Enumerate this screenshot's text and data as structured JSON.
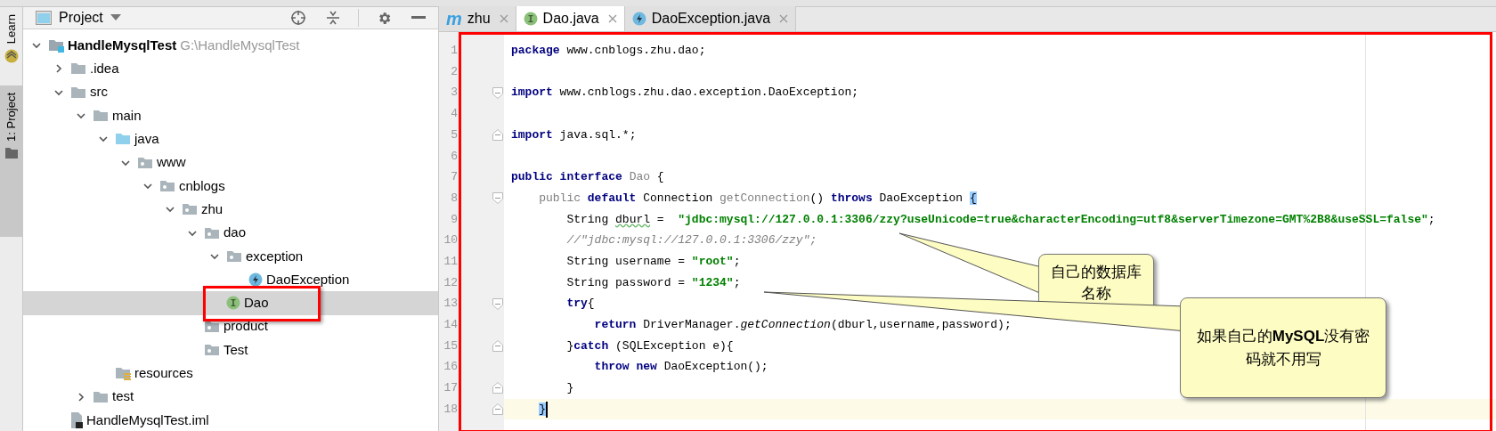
{
  "tool_strip": [
    {
      "label": "Learn",
      "kind": "learn",
      "selected": false
    },
    {
      "label": "1: Project",
      "kind": "project",
      "selected": true
    }
  ],
  "project_panel": {
    "title": "Project",
    "tree": [
      {
        "name": "HandleMysqlTest",
        "path": "G:\\HandleMysqlTest",
        "kind": "module",
        "expanded": true,
        "selected": false,
        "children": [
          {
            "name": ".idea",
            "kind": "folder",
            "expanded": false,
            "selected": false
          },
          {
            "name": "src",
            "kind": "folder",
            "expanded": true,
            "selected": false,
            "children": [
              {
                "name": "main",
                "kind": "folder",
                "expanded": true,
                "selected": false,
                "children": [
                  {
                    "name": "java",
                    "kind": "source_folder",
                    "expanded": true,
                    "selected": false,
                    "children": [
                      {
                        "name": "www",
                        "kind": "package",
                        "expanded": true,
                        "selected": false,
                        "children": [
                          {
                            "name": "cnblogs",
                            "kind": "package",
                            "expanded": true,
                            "selected": false,
                            "children": [
                              {
                                "name": "zhu",
                                "kind": "package",
                                "expanded": true,
                                "selected": false,
                                "children": [
                                  {
                                    "name": "dao",
                                    "kind": "package",
                                    "expanded": true,
                                    "selected": false,
                                    "children": [
                                      {
                                        "name": "exception",
                                        "kind": "package",
                                        "expanded": true,
                                        "selected": false,
                                        "children": [
                                          {
                                            "name": "DaoException",
                                            "kind": "exception_class",
                                            "selected": false
                                          }
                                        ]
                                      },
                                      {
                                        "name": "Dao",
                                        "kind": "interface",
                                        "selected": true
                                      }
                                    ]
                                  },
                                  {
                                    "name": "product",
                                    "kind": "package",
                                    "selected": false
                                  },
                                  {
                                    "name": "Test",
                                    "kind": "package",
                                    "selected": false
                                  }
                                ]
                              }
                            ]
                          }
                        ]
                      }
                    ]
                  },
                  {
                    "name": "resources",
                    "kind": "resources_folder",
                    "selected": false
                  }
                ]
              },
              {
                "name": "test",
                "kind": "folder",
                "expanded": false,
                "selected": false
              }
            ]
          },
          {
            "name": "HandleMysqlTest.iml",
            "kind": "iml_file",
            "selected": false
          }
        ]
      }
    ]
  },
  "editor": {
    "tabs": [
      {
        "label": "zhu",
        "kind": "module",
        "icon_text": "m",
        "selected": false
      },
      {
        "label": "Dao.java",
        "kind": "interface",
        "selected": true
      },
      {
        "label": "DaoException.java",
        "kind": "exception_class",
        "selected": false
      }
    ],
    "lines": [
      {
        "number": "1",
        "kind": "plain",
        "tokens": [
          {
            "text": "package",
            "kind": "keyword"
          },
          {
            "text": " www.cnblogs.zhu.dao;",
            "kind": "plain"
          }
        ]
      },
      {
        "number": "2",
        "kind": "plain"
      },
      {
        "number": "3",
        "kind": "fold_start",
        "tokens": [
          {
            "text": "import",
            "kind": "keyword"
          },
          {
            "text": " www.cnblogs.zhu.dao.exception.DaoException;",
            "kind": "plain"
          }
        ]
      },
      {
        "number": "4",
        "kind": "plain"
      },
      {
        "number": "5",
        "kind": "fold_end",
        "tokens": [
          {
            "text": "import",
            "kind": "keyword"
          },
          {
            "text": " java.sql.*;",
            "kind": "plain"
          }
        ]
      },
      {
        "number": "6",
        "kind": "plain"
      },
      {
        "number": "7",
        "kind": "plain",
        "tokens": [
          {
            "text": "public interface",
            "kind": "keyword"
          },
          {
            "text": " Dao",
            "kind": "unused"
          },
          {
            "text": " {",
            "kind": "plain"
          }
        ]
      },
      {
        "number": "8",
        "kind": "fold_start",
        "tokens": [
          {
            "text": "    public",
            "kind": "unused"
          },
          {
            "text": " default",
            "kind": "keyword"
          },
          {
            "text": " Connection ",
            "kind": "plain"
          },
          {
            "text": "getConnection",
            "kind": "unused"
          },
          {
            "text": "() ",
            "kind": "plain"
          },
          {
            "text": "throws",
            "kind": "keyword"
          },
          {
            "text": " DaoException ",
            "kind": "plain"
          },
          {
            "text": "{",
            "kind": "matched_brace"
          }
        ]
      },
      {
        "number": "9",
        "kind": "plain",
        "tokens": [
          {
            "text": "        String ",
            "kind": "plain"
          },
          {
            "text": "dburl",
            "kind": "typo"
          },
          {
            "text": " =  ",
            "kind": "plain"
          },
          {
            "text": "\"jdbc:mysql://127.0.0.1:3306/zzy?useUnicode=true&characterEncoding=utf8&serverTimezone=GMT%2B8&useSSL=false\"",
            "kind": "string"
          },
          {
            "text": ";",
            "kind": "plain"
          }
        ]
      },
      {
        "number": "10",
        "kind": "plain",
        "tokens": [
          {
            "text": "        //\"jdbc:mysql://127.0.0.1:3306/zzy\";",
            "kind": "comment"
          }
        ]
      },
      {
        "number": "11",
        "kind": "plain",
        "tokens": [
          {
            "text": "        String username = ",
            "kind": "plain"
          },
          {
            "text": "\"root\"",
            "kind": "string"
          },
          {
            "text": ";",
            "kind": "plain"
          }
        ]
      },
      {
        "number": "12",
        "kind": "plain",
        "tokens": [
          {
            "text": "        String password = ",
            "kind": "plain"
          },
          {
            "text": "\"1234\"",
            "kind": "string"
          },
          {
            "text": ";",
            "kind": "plain"
          }
        ]
      },
      {
        "number": "13",
        "kind": "fold_start",
        "tokens": [
          {
            "text": "        try",
            "kind": "keyword"
          },
          {
            "text": "{",
            "kind": "plain"
          }
        ]
      },
      {
        "number": "14",
        "kind": "plain",
        "tokens": [
          {
            "text": "            return",
            "kind": "keyword"
          },
          {
            "text": " DriverManager.",
            "kind": "plain"
          },
          {
            "text": "getConnection",
            "kind": "static_call"
          },
          {
            "text": "(dburl,username,password);",
            "kind": "plain"
          }
        ]
      },
      {
        "number": "15",
        "kind": "fold_end",
        "tokens": [
          {
            "text": "        }",
            "kind": "plain"
          },
          {
            "text": "catch",
            "kind": "keyword"
          },
          {
            "text": " (SQLException e){",
            "kind": "plain"
          }
        ]
      },
      {
        "number": "16",
        "kind": "plain",
        "tokens": [
          {
            "text": "            throw new",
            "kind": "keyword"
          },
          {
            "text": " DaoException();",
            "kind": "plain"
          }
        ]
      },
      {
        "number": "17",
        "kind": "fold_end",
        "tokens": [
          {
            "text": "        }",
            "kind": "plain"
          }
        ]
      },
      {
        "number": "18",
        "kind": "fold_end",
        "current": true,
        "tokens": [
          {
            "text": "    }",
            "kind": "matched_brace"
          }
        ]
      }
    ]
  },
  "callouts": [
    {
      "text": "自己的数据库名称"
    },
    {
      "text": "如果自己的**MySQL**没有密码就不用写"
    }
  ]
}
